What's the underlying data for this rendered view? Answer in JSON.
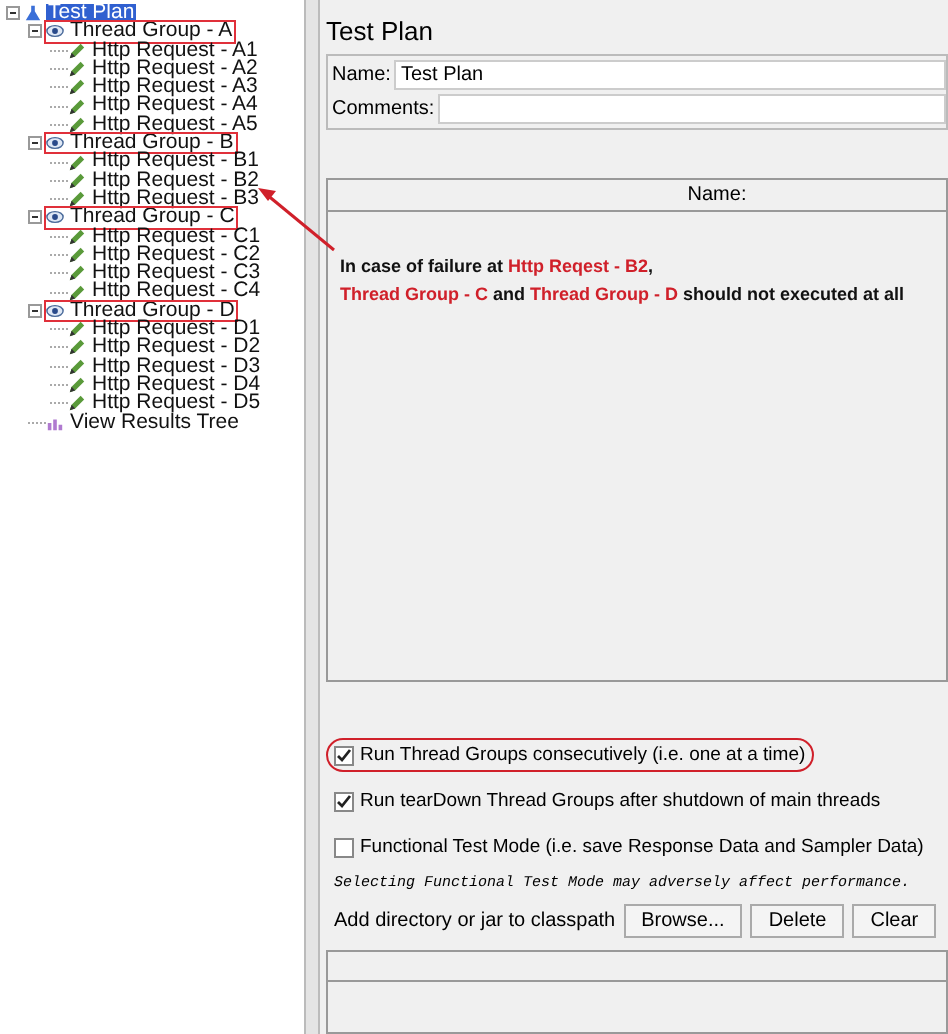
{
  "tree": {
    "label": "Test Plan",
    "kind": "plan",
    "selected": true,
    "expanded": true,
    "boxed": false,
    "children": [
      {
        "label": "Thread Group - A",
        "kind": "thread-group",
        "selected": false,
        "expanded": true,
        "boxed": true,
        "children": [
          {
            "label": "Http Request - A1",
            "kind": "sampler",
            "selected": false
          },
          {
            "label": "Http Request - A2",
            "kind": "sampler",
            "selected": false
          },
          {
            "label": "Http Request - A3",
            "kind": "sampler",
            "selected": false
          },
          {
            "label": "Http Request - A4",
            "kind": "sampler",
            "selected": false
          },
          {
            "label": "Http Request - A5",
            "kind": "sampler",
            "selected": false
          }
        ]
      },
      {
        "label": "Thread Group - B",
        "kind": "thread-group",
        "selected": false,
        "expanded": true,
        "boxed": true,
        "children": [
          {
            "label": "Http Request - B1",
            "kind": "sampler",
            "selected": false
          },
          {
            "label": "Http Request - B2",
            "kind": "sampler",
            "selected": false
          },
          {
            "label": "Http Request - B3",
            "kind": "sampler",
            "selected": false
          }
        ]
      },
      {
        "label": "Thread Group - C",
        "kind": "thread-group",
        "selected": false,
        "expanded": true,
        "boxed": true,
        "children": [
          {
            "label": "Http Request - C1",
            "kind": "sampler",
            "selected": false
          },
          {
            "label": "Http Request - C2",
            "kind": "sampler",
            "selected": false
          },
          {
            "label": "Http Request - C3",
            "kind": "sampler",
            "selected": false
          },
          {
            "label": "Http Request - C4",
            "kind": "sampler",
            "selected": false
          }
        ]
      },
      {
        "label": "Thread Group - D",
        "kind": "thread-group",
        "selected": false,
        "expanded": true,
        "boxed": true,
        "children": [
          {
            "label": "Http Request - D1",
            "kind": "sampler",
            "selected": false
          },
          {
            "label": "Http Request - D2",
            "kind": "sampler",
            "selected": false
          },
          {
            "label": "Http Request - D3",
            "kind": "sampler",
            "selected": false
          },
          {
            "label": "Http Request - D4",
            "kind": "sampler",
            "selected": false
          },
          {
            "label": "Http Request - D5",
            "kind": "sampler",
            "selected": false
          }
        ]
      },
      {
        "label": "View Results Tree",
        "kind": "listener",
        "selected": false
      }
    ]
  },
  "panel": {
    "title": "Test Plan",
    "name_label": "Name:",
    "name_value": "Test Plan",
    "comments_label": "Comments:"
  },
  "variables_table": {
    "columns": [
      "Name:"
    ]
  },
  "annotation": {
    "lines": [
      [
        {
          "text": "In case of failure at ",
          "highlight": false
        },
        {
          "text": "Http Reqest - B2",
          "highlight": true
        },
        {
          "text": ",",
          "highlight": false
        }
      ],
      [
        {
          "text": "Thread Group - C",
          "highlight": true
        },
        {
          "text": " and ",
          "highlight": false
        },
        {
          "text": "Thread Group - D",
          "highlight": true
        },
        {
          "text": " should not executed at all",
          "highlight": false
        }
      ]
    ]
  },
  "options": [
    {
      "label": "Run Thread Groups consecutively (i.e. one at a time)",
      "checked": true,
      "circled": true
    },
    {
      "label": "Run tearDown Thread Groups after shutdown of main threads",
      "checked": true,
      "circled": false
    },
    {
      "label": "Functional Test Mode (i.e. save Response Data and Sampler Data)",
      "checked": false,
      "circled": false
    }
  ],
  "warning": "Selecting Functional Test Mode may adversely affect performance.",
  "classpath": {
    "label": "Add directory or jar to classpath",
    "buttons": [
      "Browse...",
      "Delete",
      "Clear"
    ]
  }
}
